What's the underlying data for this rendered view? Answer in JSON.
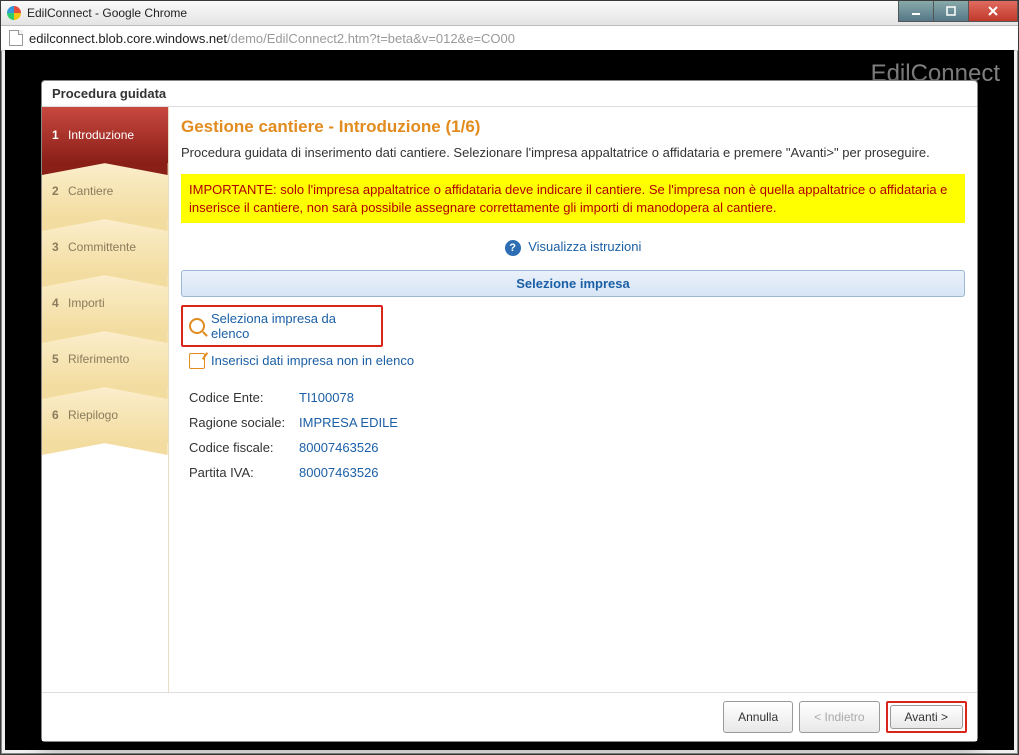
{
  "window": {
    "title": "EdilConnect - Google Chrome",
    "url_host": "edilconnect.blob.core.windows.net",
    "url_path": "/demo/EdilConnect2.htm?t=beta&v=012&e=CO00",
    "bg_brand": "EdilConnect"
  },
  "modal": {
    "title": "Procedura guidata",
    "heading": "Gestione cantiere - Introduzione (1/6)",
    "intro": "Procedura guidata di inserimento dati cantiere. Selezionare l'impresa appaltatrice o affidataria e premere \"Avanti>\" per proseguire.",
    "alert": "IMPORTANTE: solo l'impresa appaltatrice o affidataria deve indicare il cantiere. Se l'impresa non è quella appaltatrice o affidataria e inserisce il cantiere, non sarà possibile assegnare correttamente gli importi di manodopera al cantiere.",
    "instructions_link": "Visualizza istruzioni",
    "panel_title": "Selezione impresa",
    "link_select_from_list": "Seleziona impresa da elenco",
    "link_insert_manual": "Inserisci dati impresa non in elenco",
    "fields": {
      "codice_ente": {
        "label": "Codice Ente:",
        "value": "TI100078"
      },
      "ragione_sociale": {
        "label": "Ragione sociale:",
        "value": "IMPRESA EDILE"
      },
      "codice_fiscale": {
        "label": "Codice fiscale:",
        "value": "80007463526"
      },
      "partita_iva": {
        "label": "Partita IVA:",
        "value": "80007463526"
      }
    },
    "buttons": {
      "cancel": "Annulla",
      "back": "< Indietro",
      "next": "Avanti >"
    }
  },
  "steps": [
    {
      "num": "1",
      "label": "Introduzione",
      "active": true
    },
    {
      "num": "2",
      "label": "Cantiere",
      "active": false
    },
    {
      "num": "3",
      "label": "Committente",
      "active": false
    },
    {
      "num": "4",
      "label": "Importi",
      "active": false
    },
    {
      "num": "5",
      "label": "Riferimento",
      "active": false
    },
    {
      "num": "6",
      "label": "Riepilogo",
      "active": false
    }
  ]
}
